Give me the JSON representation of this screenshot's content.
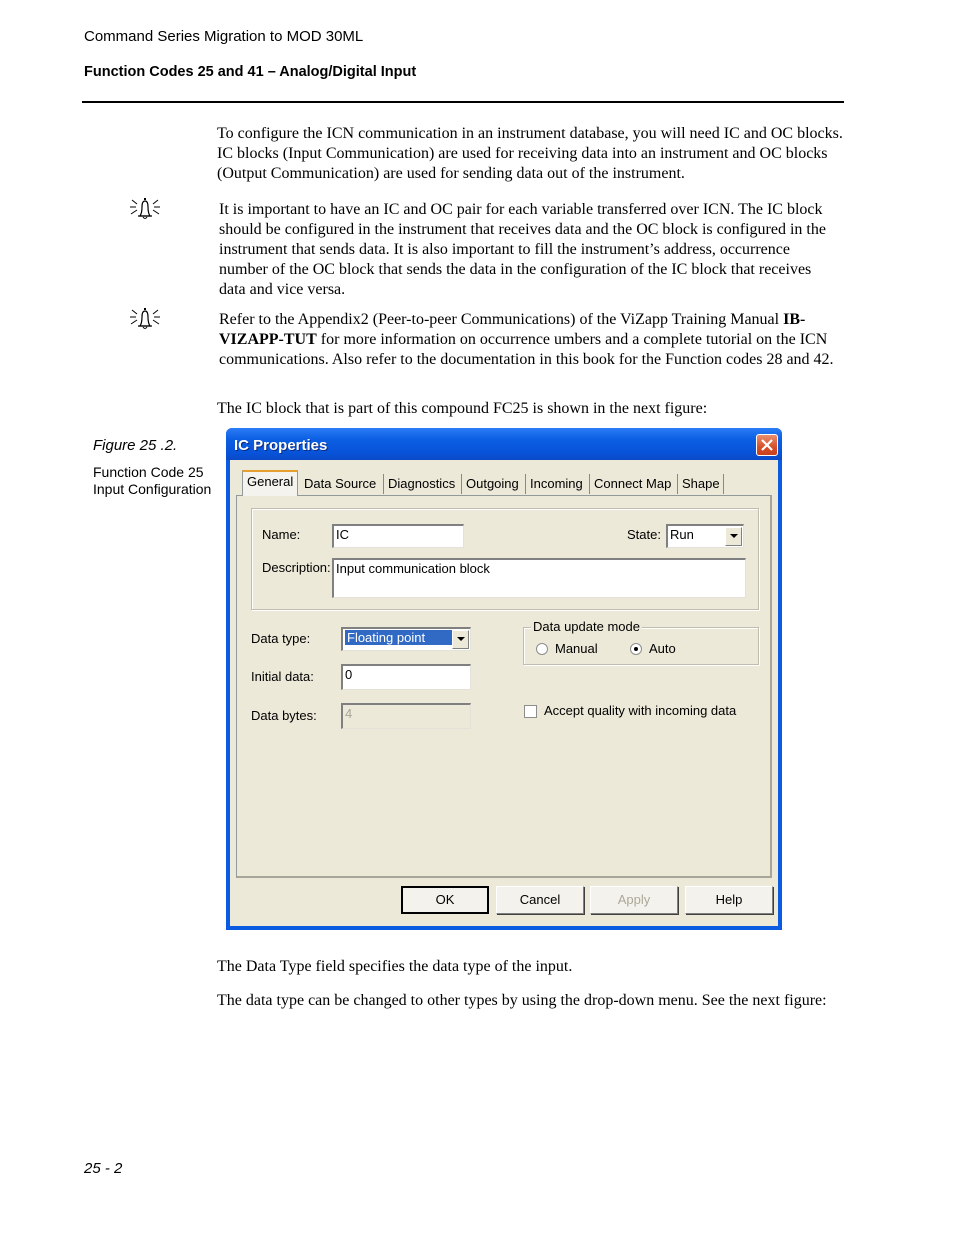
{
  "header": {
    "doc_title": "Command Series Migration to MOD 30ML",
    "section_title": "Function Codes 25 and 41 – Analog/Digital Input"
  },
  "body": {
    "para_intro": "To configure the ICN communication in an instrument database, you will need IC and OC blocks. IC blocks (Input Communication) are used for receiving data into an instrument and OC blocks (Output Communication) are used for sending data out of the instrument.",
    "note1": "It is important to have an IC and OC pair for each variable transferred over ICN. The IC block should be configured in the instrument that receives data and the OC block is configured in the instrument that sends data. It is also important to fill the instrument’s address, occurrence number of the OC block that sends the data in the configuration of the IC block that receives data and vice versa.",
    "note2_pre": "Refer to the Appendix2 (Peer-to-peer Communications) of the ViZapp Training Manual ",
    "note2_bold": "IB-VIZAPP-TUT",
    "note2_post": " for more information on occurrence umbers and a complete tutorial on the ICN communications. Also refer to the documentation in this book for the Function codes 28 and 42.",
    "para_figure_intro": "The IC block that is part of this compound FC25 is shown in the next figure:",
    "para_data_type": "The Data Type field specifies the data type of the input.",
    "para_dropdown": "The data type can be changed to other types by using the drop-down menu. See the next figure:"
  },
  "figure": {
    "label": "Figure 25 .2.",
    "caption": "Function Code 25 Input Configuration"
  },
  "dialog": {
    "title": "IC Properties",
    "tabs": [
      "General",
      "Data Source",
      "Diagnostics",
      "Outgoing",
      "Incoming",
      "Connect Map",
      "Shape"
    ],
    "active_tab": "General",
    "name_label": "Name:",
    "name_value": "IC",
    "state_label": "State:",
    "state_value": "Run",
    "description_label": "Description:",
    "description_value": "Input communication block",
    "data_type_label": "Data type:",
    "data_type_value": "Floating point",
    "initial_data_label": "Initial data:",
    "initial_data_value": "0",
    "data_bytes_label": "Data bytes:",
    "data_bytes_value": "4",
    "update_mode_legend": "Data update mode",
    "update_mode_options": [
      "Manual",
      "Auto"
    ],
    "update_mode_selected": "Auto",
    "accept_quality_label": "Accept quality with incoming data",
    "accept_quality_checked": false,
    "buttons": {
      "ok": "OK",
      "cancel": "Cancel",
      "apply": "Apply",
      "help": "Help"
    }
  },
  "footer": {
    "page_number": "25 - 2"
  }
}
